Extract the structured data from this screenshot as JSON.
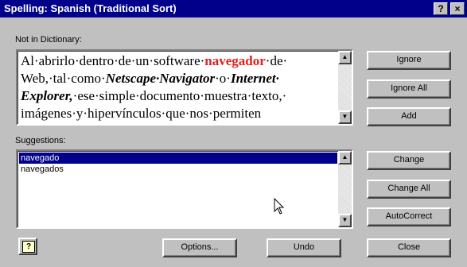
{
  "window": {
    "title": "Spelling: Spanish (Traditional Sort)",
    "help_glyph": "?",
    "close_glyph": "×"
  },
  "not_in_dictionary": {
    "label": "Not in Dictionary:",
    "line1_pre": "Al·abrirlo·dentro·de·un·software·",
    "line1_word": "navegador",
    "line1_post": "·de·",
    "line2_pre": "Web,·tal·como·",
    "line2_bi1": "Netscape·Navigator",
    "line2_mid": "·o·",
    "line2_bi2": "Internet·",
    "line3_bi": "Explorer,",
    "line3_post": "·ese·simple·documento·muestra·texto,·",
    "line4": "imágenes·y·hipervínculos·que·nos·permiten"
  },
  "suggestions": {
    "label": "Suggestions:",
    "items": [
      "navegado",
      "navegados"
    ],
    "selected_index": 0
  },
  "buttons": {
    "ignore": "Ignore",
    "ignore_all": "Ignore All",
    "add": "Add",
    "change": "Change",
    "change_all": "Change All",
    "autocorrect": "AutoCorrect",
    "options": "Options...",
    "undo": "Undo",
    "close": "Close"
  },
  "icons": {
    "scroll_up": "up-arrow-icon",
    "scroll_down": "down-arrow-icon",
    "help": "help-icon",
    "mouse_cursor": "mouse-pointer-icon"
  }
}
